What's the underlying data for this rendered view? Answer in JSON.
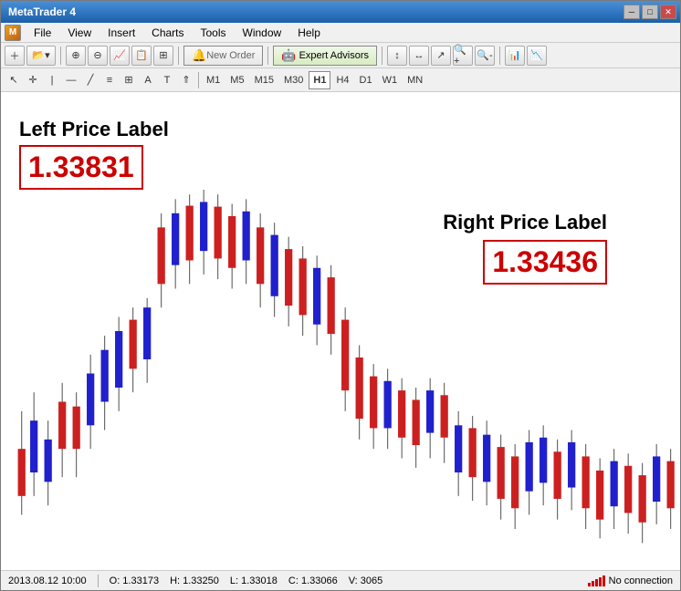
{
  "window": {
    "title": "MetaTrader 4"
  },
  "titlebar": {
    "minimize": "─",
    "maximize": "□",
    "close": "✕"
  },
  "menu": {
    "logo": "M",
    "items": [
      "File",
      "View",
      "Insert",
      "Charts",
      "Tools",
      "Window",
      "Help"
    ]
  },
  "toolbar": {
    "new_order": "New Order",
    "expert_advisors": "Expert Advisors"
  },
  "timeframes": [
    "M1",
    "M5",
    "M15",
    "M30",
    "H1",
    "H4",
    "D1",
    "W1",
    "MN"
  ],
  "active_timeframe": "H1",
  "chart": {
    "left_label": "Left Price Label",
    "left_price": "1.33831",
    "right_label": "Right Price Label",
    "right_price": "1.33436"
  },
  "status": {
    "datetime": "2013.08.12 10:00",
    "open": "O: 1.33173",
    "high": "H: 1.33250",
    "low": "L: 1.33018",
    "close": "C: 1.33066",
    "volume": "V: 3065",
    "connection": "No connection"
  },
  "colors": {
    "bull": "#2020cc",
    "bear": "#cc2020",
    "wick": "#555555"
  }
}
